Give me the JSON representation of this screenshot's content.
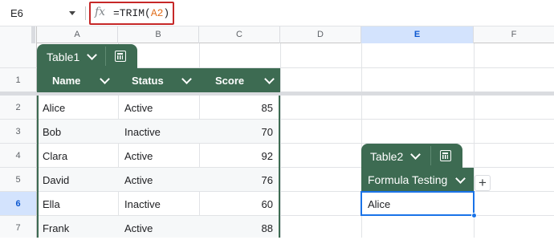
{
  "formula_bar": {
    "name_box": "E6",
    "fx_label": "fx",
    "formula_prefix": "=TRIM(",
    "formula_ref": "A2",
    "formula_suffix": ")"
  },
  "columns": [
    "A",
    "B",
    "C",
    "D",
    "E",
    "F"
  ],
  "rows": [
    "1",
    "2",
    "3",
    "4",
    "5",
    "6",
    "7"
  ],
  "selected_cell": "E6",
  "table1": {
    "name": "Table1",
    "headers": [
      "Name",
      "Status",
      "Score"
    ],
    "rows": [
      [
        "Alice",
        "Active",
        "85"
      ],
      [
        "Bob",
        "Inactive",
        "70"
      ],
      [
        "Clara",
        "Active",
        "92"
      ],
      [
        "David",
        "Active",
        "76"
      ],
      [
        "Ella",
        "Inactive",
        "60"
      ],
      [
        "Frank",
        "Active",
        "88"
      ]
    ]
  },
  "table2": {
    "name": "Table2",
    "header": "Formula Testing",
    "value": "Alice",
    "add_column_label": "+"
  },
  "colors": {
    "table_header": "#3d6b52",
    "selection": "#1a73e8",
    "formula_ref": "#e06d1a",
    "highlight_box": "#c62828"
  }
}
